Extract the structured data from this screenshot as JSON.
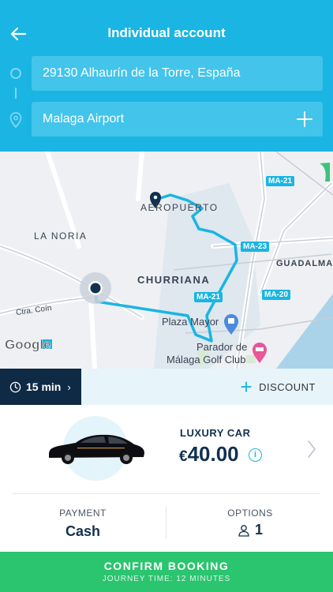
{
  "header": {
    "title": "Individual account",
    "back_icon": "arrow-left-icon"
  },
  "route": {
    "from": "29130 Alhaurín de la Torre, España",
    "to": "Malaga Airport",
    "add_stop_icon": "plus-icon"
  },
  "map": {
    "labels": {
      "aeropuerto": "AEROPUERTO",
      "la_noria": "LA NORIA",
      "churriana": "CHURRIANA",
      "guadalma": "GUADALMA",
      "ctra_coin": "Ctra. Coín",
      "plaza_mayor": "Plaza Mayor",
      "parador_1": "Parador de",
      "parador_2": "Málaga Golf Club",
      "google": "Google"
    },
    "road_badges": [
      "MA-21",
      "MA-23",
      "MA-21",
      "MA-20"
    ],
    "colors": {
      "route": "#1ab5e2",
      "pin": "#12304f"
    }
  },
  "eta": {
    "label": "15 min",
    "chevron": "›"
  },
  "discount": {
    "label": "DISCOUNT",
    "icon": "+"
  },
  "vehicle": {
    "category": "LUXURY CAR",
    "currency": "€",
    "price": "40.00",
    "info_icon": "i"
  },
  "payment": {
    "label": "PAYMENT",
    "value": "Cash"
  },
  "options": {
    "label": "OPTIONS",
    "value": "1"
  },
  "confirm": {
    "label": "CONFIRM BOOKING",
    "subtitle": "JOURNEY TIME: 12 MINUTES"
  },
  "colors": {
    "header": "#1ab5e2",
    "field": "#43c4ea",
    "dark": "#12304f",
    "confirm": "#2bc46f"
  }
}
